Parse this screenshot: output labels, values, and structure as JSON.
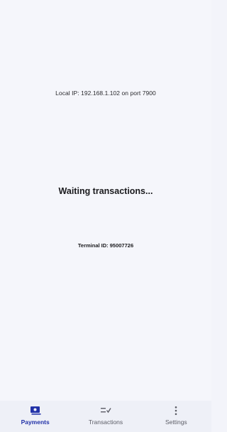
{
  "main": {
    "local_ip_text": "Local IP: 192.168.1.102 on port 7900",
    "waiting_text": "Waiting transactions...",
    "terminal_id_text": "Terminal ID: 95007726"
  },
  "bottom_nav": {
    "items": [
      {
        "label": "Payments",
        "icon": "payments-icon",
        "active": true
      },
      {
        "label": "Transactions",
        "icon": "transactions-icon",
        "active": false
      },
      {
        "label": "Settings",
        "icon": "settings-icon",
        "active": false
      }
    ]
  },
  "colors": {
    "background": "#f5f6fb",
    "nav_background": "#eef0f7",
    "active": "#2232a8",
    "inactive": "#5c5d66"
  }
}
